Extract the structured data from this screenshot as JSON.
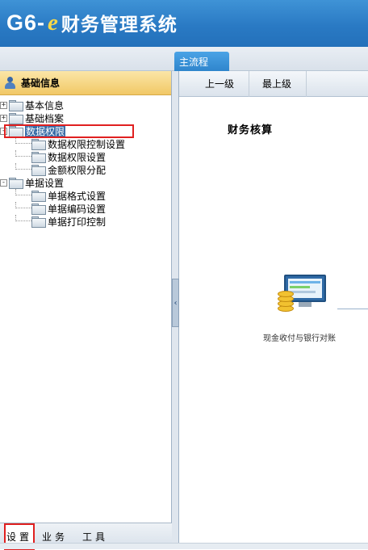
{
  "app": {
    "logo_brand": "G6-",
    "logo_e": "e",
    "logo_name": "财务管理系统"
  },
  "top_tab": {
    "label": "主流程"
  },
  "left_panel": {
    "title": "基础信息",
    "tree": {
      "n1": {
        "label": "基本信息",
        "toggle": "+"
      },
      "n2": {
        "label": "基础档案",
        "toggle": "+"
      },
      "n3": {
        "label": "数据权限",
        "toggle": "-"
      },
      "n3a": {
        "label": "数据权限控制设置"
      },
      "n3b": {
        "label": "数据权限设置"
      },
      "n3c": {
        "label": "金额权限分配"
      },
      "n4": {
        "label": "单据设置",
        "toggle": "-"
      },
      "n4a": {
        "label": "单据格式设置"
      },
      "n4b": {
        "label": "单据编码设置"
      },
      "n4c": {
        "label": "单据打印控制"
      }
    },
    "bottom_tabs": {
      "t1": "设置",
      "t2": "业务",
      "t3": "工具"
    }
  },
  "toolbar": {
    "up_one": "上一级",
    "top_level": "最上级"
  },
  "main": {
    "section_title": "财务核算",
    "flow_item_label": "现金收付与银行对账"
  },
  "colors": {
    "header_blue": "#2a7ac4",
    "highlight_red": "#e02020",
    "panel_gold": "#f1c866"
  }
}
